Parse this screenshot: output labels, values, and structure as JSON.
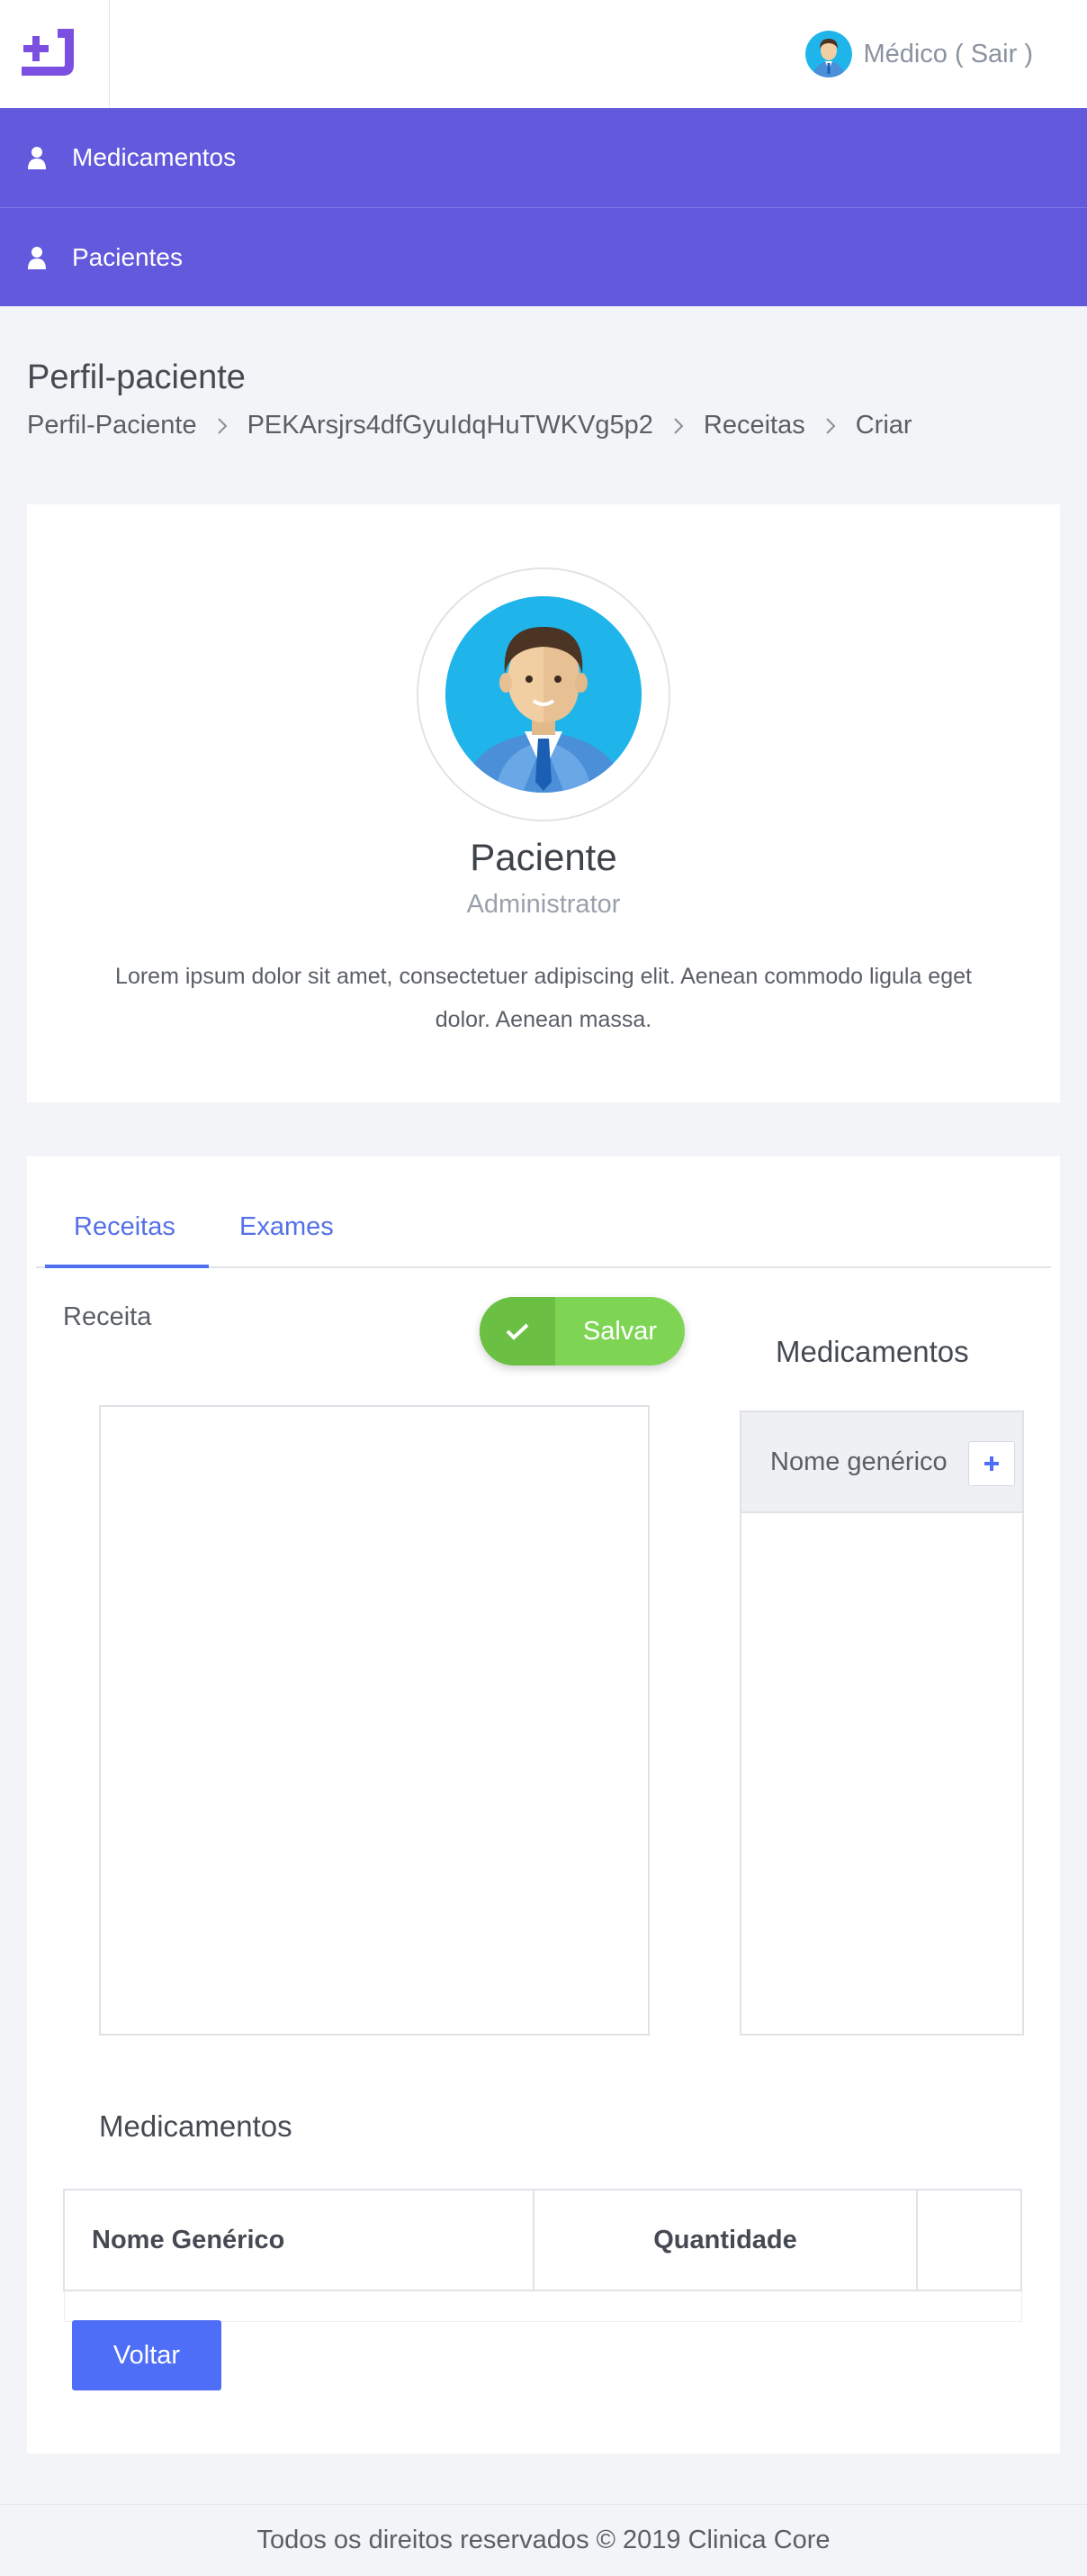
{
  "header": {
    "user_label": "Médico ( Sair )"
  },
  "nav": {
    "items": [
      {
        "label": "Medicamentos",
        "icon": "user-icon"
      },
      {
        "label": "Pacientes",
        "icon": "user-icon"
      }
    ]
  },
  "page": {
    "title": "Perfil-paciente",
    "breadcrumb": [
      "Perfil-Paciente",
      "PEKArsjrs4dfGyuIdqHuTWKVg5p2",
      "Receitas",
      "Criar"
    ]
  },
  "profile": {
    "name": "Paciente",
    "role": "Administrator",
    "description": "Lorem ipsum dolor sit amet, consectetuer adipiscing elit. Aenean commodo ligula eget dolor. Aenean massa."
  },
  "tabs": {
    "items": [
      "Receitas",
      "Exames"
    ],
    "active": "Receitas"
  },
  "form": {
    "receita_label": "Receita",
    "save_label": "Salvar",
    "medicamentos_title": "Medicamentos",
    "search_column_header": "Nome genérico"
  },
  "table": {
    "title": "Medicamentos",
    "columns": [
      "Nome Genérico",
      "Quantidade",
      ""
    ],
    "rows": []
  },
  "actions": {
    "back_label": "Voltar"
  },
  "footer": {
    "text": "Todos os direitos reservados © 2019 Clinica Core"
  },
  "colors": {
    "nav_bg": "#6259dd",
    "accent_blue": "#4f6ef7",
    "save_green": "#7ed553",
    "logo_purple": "#7b4fe0"
  }
}
